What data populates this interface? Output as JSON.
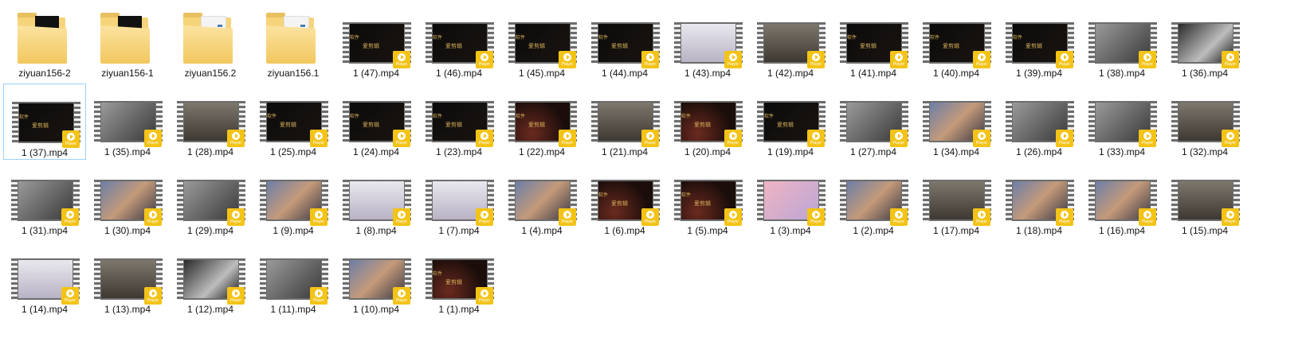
{
  "folders": [
    {
      "name": "ziyuan156-2",
      "style": "dark"
    },
    {
      "name": "ziyuan156-1",
      "style": "dark"
    },
    {
      "name": "ziyuan156.2",
      "style": "light"
    },
    {
      "name": "ziyuan156.1",
      "style": "light"
    }
  ],
  "videos": [
    {
      "name": "1 (47).mp4",
      "thumb": "promo"
    },
    {
      "name": "1 (46).mp4",
      "thumb": "promo"
    },
    {
      "name": "1 (45).mp4",
      "thumb": "promo"
    },
    {
      "name": "1 (44).mp4",
      "thumb": "promo"
    },
    {
      "name": "1 (43).mp4",
      "thumb": "bright"
    },
    {
      "name": "1 (42).mp4",
      "thumb": "room"
    },
    {
      "name": "1 (41).mp4",
      "thumb": "promo"
    },
    {
      "name": "1 (40).mp4",
      "thumb": "promo"
    },
    {
      "name": "1 (39).mp4",
      "thumb": "promo"
    },
    {
      "name": "1 (38).mp4",
      "thumb": "gray"
    },
    {
      "name": "1 (36).mp4",
      "thumb": "darkgray"
    },
    {
      "name": "1 (37).mp4",
      "thumb": "promo",
      "selected": true
    },
    {
      "name": "1 (35).mp4",
      "thumb": "gray"
    },
    {
      "name": "1 (28).mp4",
      "thumb": "room"
    },
    {
      "name": "1 (25).mp4",
      "thumb": "promo"
    },
    {
      "name": "1 (24).mp4",
      "thumb": "promo"
    },
    {
      "name": "1 (23).mp4",
      "thumb": "promo"
    },
    {
      "name": "1 (22).mp4",
      "thumb": "promo-red"
    },
    {
      "name": "1 (21).mp4",
      "thumb": "room"
    },
    {
      "name": "1 (20).mp4",
      "thumb": "promo-red"
    },
    {
      "name": "1 (19).mp4",
      "thumb": "promo"
    },
    {
      "name": "1 (27).mp4",
      "thumb": "gray"
    },
    {
      "name": "1 (34).mp4",
      "thumb": "color"
    },
    {
      "name": "1 (26).mp4",
      "thumb": "gray"
    },
    {
      "name": "1 (33).mp4",
      "thumb": "gray"
    },
    {
      "name": "1 (32).mp4",
      "thumb": "room"
    },
    {
      "name": "1 (31).mp4",
      "thumb": "gray"
    },
    {
      "name": "1 (30).mp4",
      "thumb": "color"
    },
    {
      "name": "1 (29).mp4",
      "thumb": "gray"
    },
    {
      "name": "1 (9).mp4",
      "thumb": "color"
    },
    {
      "name": "1 (8).mp4",
      "thumb": "bright"
    },
    {
      "name": "1 (7).mp4",
      "thumb": "bright"
    },
    {
      "name": "1 (4).mp4",
      "thumb": "color"
    },
    {
      "name": "1 (6).mp4",
      "thumb": "promo-red"
    },
    {
      "name": "1 (5).mp4",
      "thumb": "promo-red"
    },
    {
      "name": "1 (3).mp4",
      "thumb": "pink"
    },
    {
      "name": "1 (2).mp4",
      "thumb": "color"
    },
    {
      "name": "1 (17).mp4",
      "thumb": "room"
    },
    {
      "name": "1 (18).mp4",
      "thumb": "color"
    },
    {
      "name": "1 (16).mp4",
      "thumb": "color"
    },
    {
      "name": "1 (15).mp4",
      "thumb": "room"
    },
    {
      "name": "1 (14).mp4",
      "thumb": "bright"
    },
    {
      "name": "1 (13).mp4",
      "thumb": "room"
    },
    {
      "name": "1 (12).mp4",
      "thumb": "darkgray"
    },
    {
      "name": "1 (11).mp4",
      "thumb": "gray"
    },
    {
      "name": "1 (10).mp4",
      "thumb": "color"
    },
    {
      "name": "1 (1).mp4",
      "thumb": "promo-red"
    }
  ],
  "promo_text": {
    "line1": "软件",
    "line2": "爱剪辑"
  },
  "badge_text": "Player",
  "colors": {
    "folder": "#f6d47a",
    "badge": "#f3c316",
    "selection": "#99d1ff"
  }
}
